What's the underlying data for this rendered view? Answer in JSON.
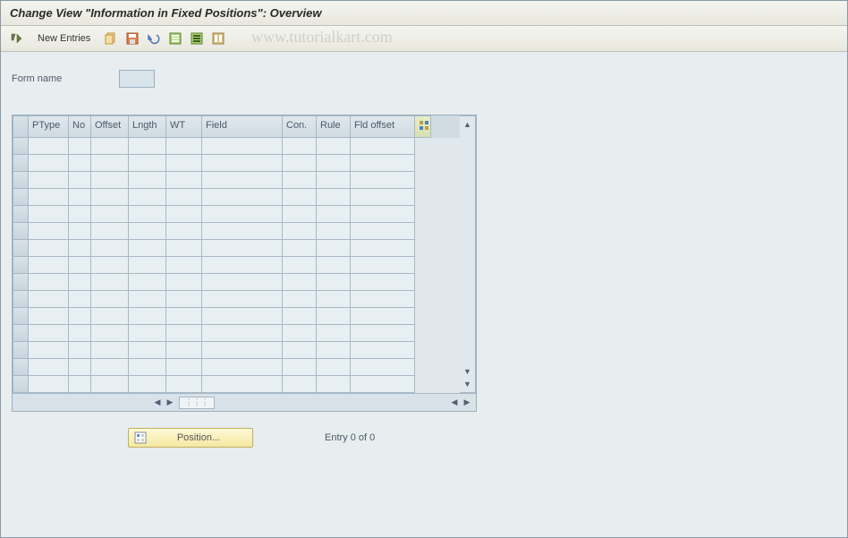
{
  "title": "Change View \"Information in Fixed Positions\": Overview",
  "toolbar": {
    "new_entries_label": "New Entries"
  },
  "watermark": "www.tutorialkart.com",
  "form": {
    "name_label": "Form name",
    "name_value": ""
  },
  "table": {
    "columns": [
      "PType",
      "No",
      "Offset",
      "Lngth",
      "WT",
      "Field",
      "Con.",
      "Rule",
      "Fld offset"
    ],
    "rows_visible": 15
  },
  "footer": {
    "position_label": "Position...",
    "entry_text": "Entry 0 of 0"
  }
}
